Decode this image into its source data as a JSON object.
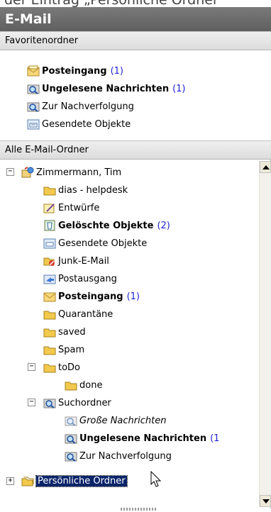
{
  "caption_cut": "der Eintrag „Persönliche Ordner\"",
  "panel": {
    "title": "E-Mail"
  },
  "favorites": {
    "header": "Favoritenordner",
    "items": [
      {
        "label": "Posteingang",
        "count": "(1)",
        "bold": true,
        "icon": "inbox-icon"
      },
      {
        "label": "Ungelesene Nachrichten",
        "count": "(1)",
        "bold": true,
        "icon": "search-folder-icon"
      },
      {
        "label": "Zur Nachverfolgung",
        "count": "",
        "bold": false,
        "icon": "search-folder-icon"
      },
      {
        "label": "Gesendete Objekte",
        "count": "",
        "bold": false,
        "icon": "sent-items-icon"
      }
    ]
  },
  "all_folders": {
    "header": "Alle E-Mail-Ordner",
    "root": "Zimmermann, Tim",
    "items": [
      {
        "label": "dias - helpdesk",
        "count": ""
      },
      {
        "label": "Entwürfe",
        "count": ""
      },
      {
        "label": "Gelöschte Objekte",
        "count": "(2)"
      },
      {
        "label": "Gesendete Objekte",
        "count": ""
      },
      {
        "label": "Junk-E-Mail",
        "count": ""
      },
      {
        "label": "Postausgang",
        "count": ""
      },
      {
        "label": "Posteingang",
        "count": "(1)"
      },
      {
        "label": "Quarantäne",
        "count": ""
      },
      {
        "label": "saved",
        "count": ""
      },
      {
        "label": "Spam",
        "count": ""
      },
      {
        "label": "toDo",
        "count": ""
      },
      {
        "label": "done",
        "count": ""
      },
      {
        "label": "Suchordner",
        "count": ""
      },
      {
        "label": "Große Nachrichten",
        "count": ""
      },
      {
        "label": "Ungelesene Nachrichten",
        "count": "(1"
      },
      {
        "label": "Zur Nachverfolgung",
        "count": ""
      }
    ],
    "personal": "Persönliche Ordner"
  },
  "colors": {
    "count": "#1f1fd6",
    "selection": "#0a246a",
    "title_bar": "#6b6b6b"
  }
}
